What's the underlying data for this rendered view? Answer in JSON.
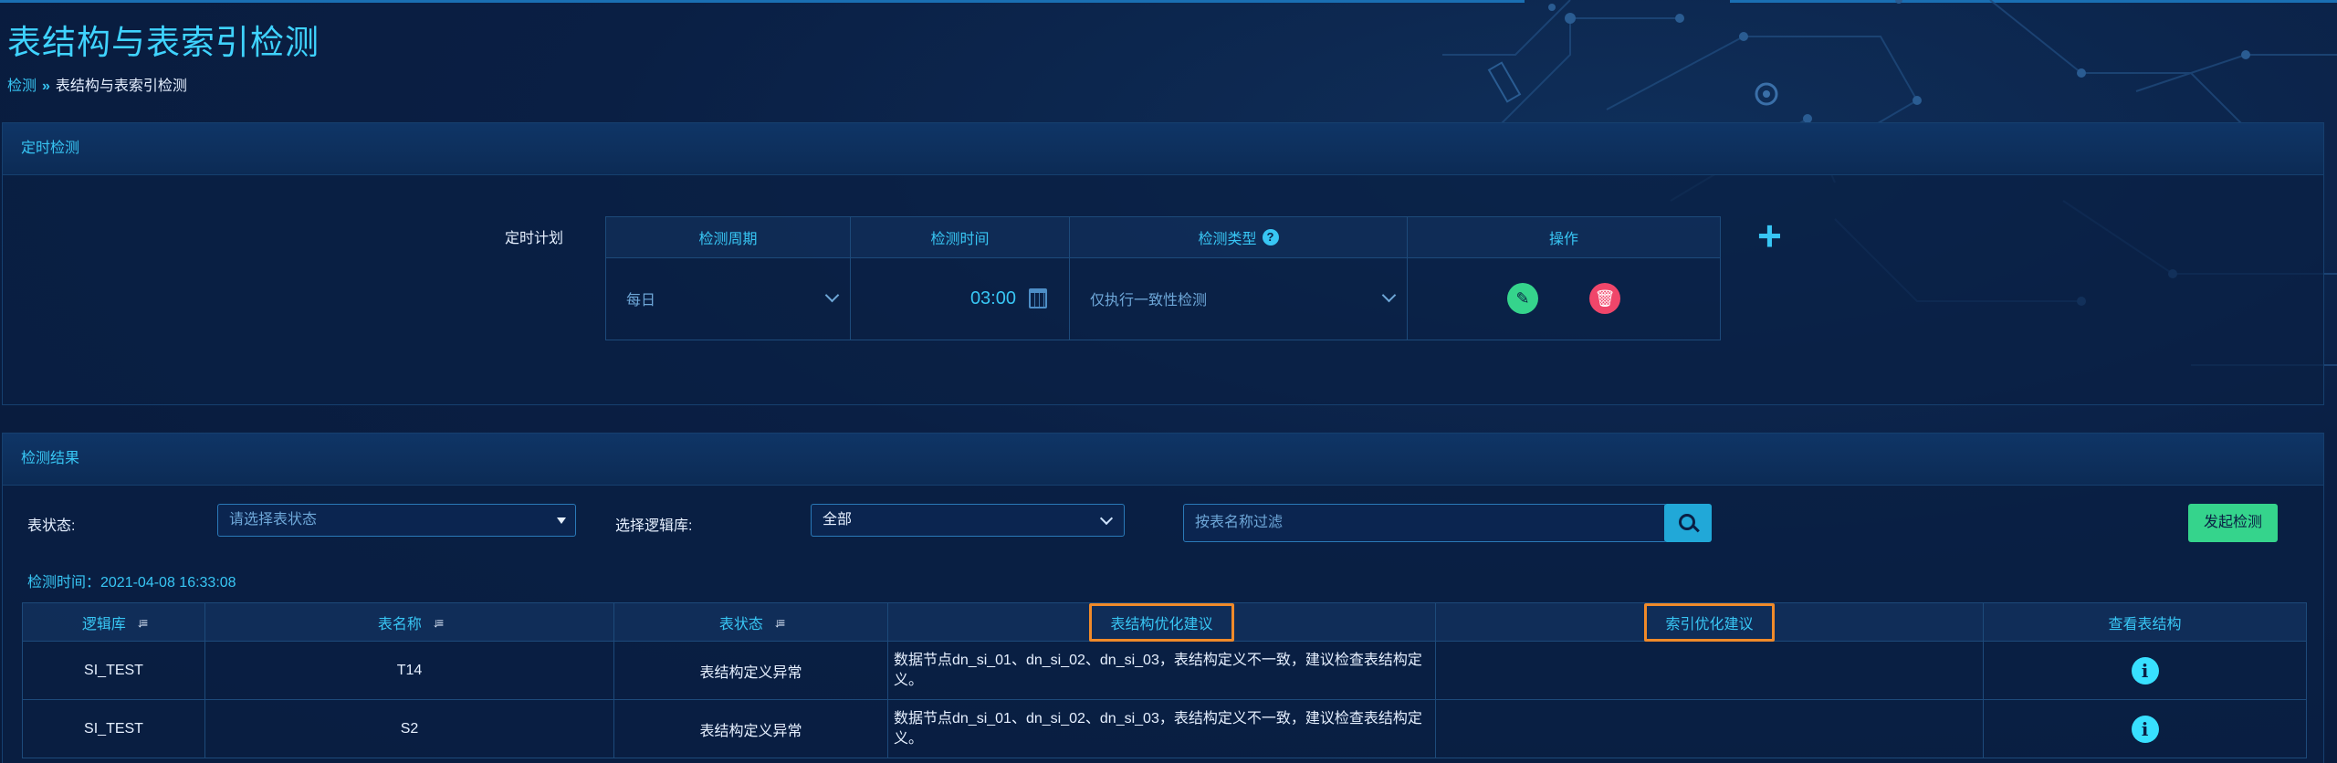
{
  "page": {
    "title": "表结构与表索引检测",
    "breadcrumb": {
      "parent": "检测",
      "separator": "»",
      "current": "表结构与表索引检测"
    }
  },
  "scheduled": {
    "panel_title": "定时检测",
    "plan_label": "定时计划",
    "columns": [
      "检测周期",
      "检测时间",
      "检测类型",
      "操作"
    ],
    "row": {
      "period": "每日",
      "time": "03:00",
      "type": "仅执行一致性检测"
    },
    "help_icon": "?",
    "edit_icon": "✎",
    "delete_icon": "🗑",
    "add_icon": "+"
  },
  "results": {
    "panel_title": "检测结果",
    "filters": {
      "status_label": "表状态:",
      "status_placeholder": "请选择表状态",
      "db_label": "选择逻辑库:",
      "db_value": "全部",
      "search_placeholder": "按表名称过滤",
      "launch_button": "发起检测"
    },
    "check_time": "检测时间：2021-04-08 16:33:08",
    "columns": [
      "逻辑库",
      "表名称",
      "表状态",
      "表结构优化建议",
      "索引优化建议",
      "查看表结构"
    ],
    "sort_icon": "↓≡",
    "info_icon": "i",
    "rows": [
      {
        "db": "SI_TEST",
        "table": "T14",
        "status": "表结构定义异常",
        "struct_advice": "数据节点dn_si_01、dn_si_02、dn_si_03，表结构定义不一致，建议检查表结构定义。",
        "index_advice": ""
      },
      {
        "db": "SI_TEST",
        "table": "S2",
        "status": "表结构定义异常",
        "struct_advice": "数据节点dn_si_01、dn_si_02、dn_si_03，表结构定义不一致，建议检查表结构定义。",
        "index_advice": ""
      }
    ]
  },
  "colors": {
    "accent": "#38c6f4",
    "success": "#35d48c",
    "danger": "#f0466a",
    "highlight": "#f08a2a",
    "background": "#0a1f44"
  }
}
